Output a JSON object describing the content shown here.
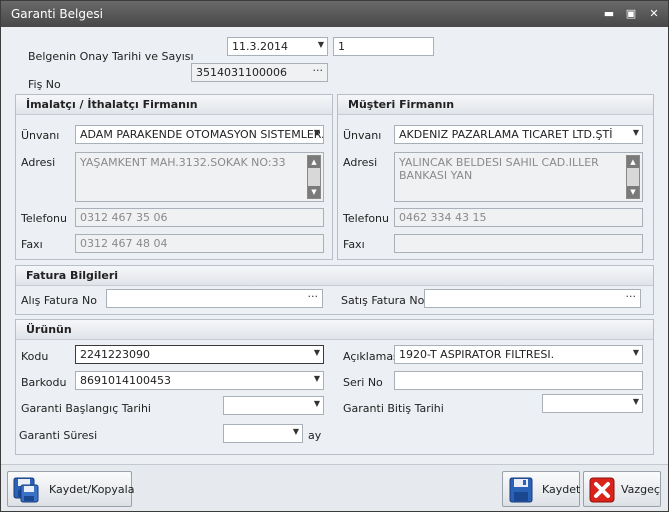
{
  "window": {
    "title": "Garanti Belgesi",
    "min_glyph": "▬",
    "max_glyph": "▣",
    "close_glyph": "✕"
  },
  "top": {
    "onay_label": "Belgenin Onay Tarihi ve Sayısı",
    "onay_date": "11.3.2014",
    "onay_sayi": "1",
    "fis_label": "Fiş No",
    "fis_no": "3514031100006"
  },
  "imalatci": {
    "header": "İmalatçı / İthalatçı Firmanın",
    "unvan_label": "Ünvanı",
    "unvan": "ADAM PARAKENDE OTOMASYON SISTEMLER...",
    "adres_label": "Adresi",
    "adres": "YAŞAMKENT MAH.3132.SOKAK NO:33",
    "telefon_label": "Telefonu",
    "telefon": "0312 467 35 06",
    "fax_label": "Faxı",
    "fax": "0312 467 48 04"
  },
  "musteri": {
    "header": "Müşteri Firmanın",
    "unvan_label": "Ünvanı",
    "unvan": "AKDENIZ PAZARLAMA TICARET LTD.ŞTİ",
    "adres_label": "Adresi",
    "adres": "YALINCAK BELDESI SAHIL CAD.ILLER BANKASI YAN",
    "telefon_label": "Telefonu",
    "telefon": "0462 334 43 15",
    "fax_label": "Faxı",
    "fax": ""
  },
  "fatura": {
    "header": "Fatura Bilgileri",
    "alis_label": "Alış Fatura No",
    "alis": "",
    "satis_label": "Satış Fatura No",
    "satis": ""
  },
  "urun": {
    "header": "Ürünün",
    "kodu_label": "Kodu",
    "kodu": "2241223090",
    "aciklama_label": "Açıklaması",
    "aciklama": "1920-T ASPIRATOR FILTRESI.",
    "barkod_label": "Barkodu",
    "barkod": "8691014100453",
    "seri_label": "Seri No",
    "seri": "",
    "baslangic_label": "Garanti Başlangıç Tarihi",
    "baslangic": "",
    "bitis_label": "Garanti Bitiş Tarihi",
    "bitis": "",
    "sure_label": "Garanti Süresi",
    "sure": "",
    "sure_unit": "ay"
  },
  "buttons": {
    "kaydet_kopyala": "Kaydet/Kopyala",
    "kaydet": "Kaydet",
    "vazgec": "Vazgeç"
  },
  "glyphs": {
    "dropdown": "▼",
    "dots": "···",
    "up": "▲",
    "down": "▼"
  },
  "colors": {
    "titlebar": "#474747",
    "window_bg": "#eceff3",
    "cancel_red": "#d9231b",
    "floppy_blue": "#2a62b8"
  }
}
